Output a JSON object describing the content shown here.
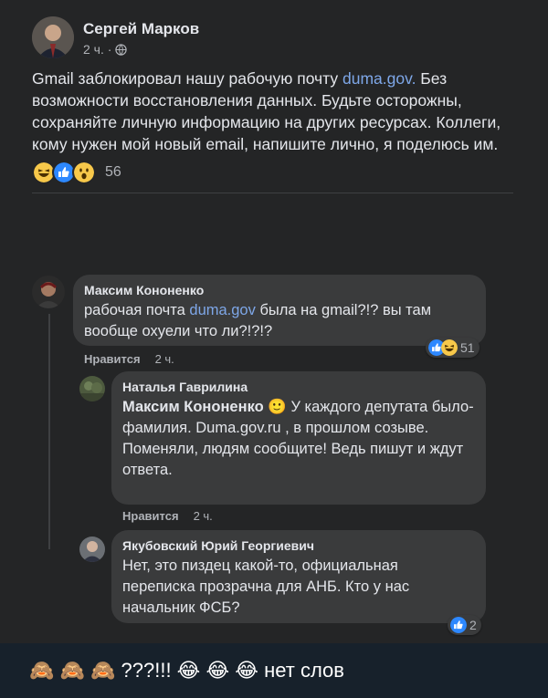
{
  "post": {
    "author": "Сергей Марков",
    "time": "2 ч. ·",
    "text_before_link": "Gmail заблокировал нашу рабочую почту ",
    "link": "duma.gov.",
    "text_after_link": " Без возможности восстановления данных. Будьте осторожны, сохраняйте личную информацию на других ресурсах. Коллеги, кому нужен мой новый email, напишите лично, я поделюсь им.",
    "reactions": [
      "haha-icon",
      "like-icon",
      "wow-icon"
    ],
    "reaction_count": "56"
  },
  "comments": [
    {
      "author": "Максим Кононенко",
      "text_before_link": "рабочая почта ",
      "link": "duma.gov",
      "text_after_link": " была на gmail?!? вы там вообще охуели что ли?!?!?",
      "like_label": "Нравится",
      "time": "2 ч.",
      "reactions": [
        "like-icon",
        "haha-icon"
      ],
      "reaction_count": "51"
    },
    {
      "author": "Наталья Гаврилина",
      "mention": "Максим Кононенко",
      "mention_emoji": "🙂",
      "text": "У каждого депутата было- фамилия. Duma.gov.ru , в прошлом созыве.",
      "text2": "Поменяли, людям сообщите! Ведь пишут и ждут ответа.",
      "like_label": "Нравится",
      "time": "2 ч."
    },
    {
      "author": "Якубовский Юрий Георгиевич",
      "text": "Нет, это пиздец какой-то, официальная переписка прозрачна для АНБ. Кто у нас начальник ФСБ?",
      "reactions": [
        "like-icon"
      ],
      "reaction_count": "2"
    }
  ],
  "footer": {
    "text": "🙈 🙈 🙈 ???!!! 😂 😂 😂 нет слов"
  },
  "colors": {
    "background": "#242526",
    "bubble": "#3a3b3c",
    "link": "#7ea7e8",
    "footer_bg": "#17212b"
  }
}
